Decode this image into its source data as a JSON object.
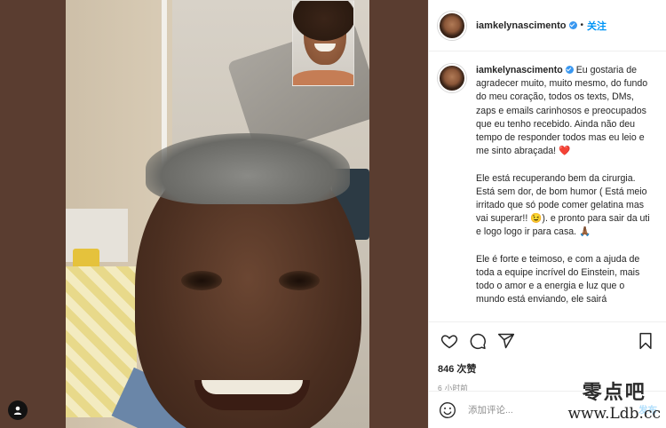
{
  "post": {
    "username": "iamkelynascimento",
    "follow_label": "关注",
    "dot": "•",
    "caption_username": "iamkelynascimento",
    "caption_p1": "Eu gostaria de agradecer muito, muito mesmo, do fundo do meu coração, todos os texts, DMs, zaps e emails carinhosos e preocupados que eu tenho recebido. Ainda não deu tempo de responder todos mas eu leio e me sinto abraçada!",
    "caption_p1_emoji": "❤️",
    "caption_p2": "Ele está recuperando bem da cirurgia. Está sem dor, de bom humor ( Está meio irritado que só pode comer gelatina mas vai superar!! 😉). e pronto para sair da uti e logo logo ir para casa. 🙏🏾",
    "caption_p3": "Ele é forte e teimoso, e com a ajuda de toda a equipe incrível do Einstein, mais todo o amor e a energia e luz que o mundo está enviando, ele sairá",
    "likes": "846 次赞",
    "time": "6 小时前",
    "comment_placeholder": "添加评论...",
    "post_label": "发布"
  },
  "icons": {
    "like": "heart-icon",
    "comment": "comment-bubble-icon",
    "share": "paper-plane-icon",
    "save": "bookmark-icon",
    "emoji": "smiley-icon",
    "tags": "person-tag-icon"
  },
  "watermark": {
    "chinese": "零点吧",
    "url": "www.Ldb.cc"
  },
  "colors": {
    "accent": "#0095f6",
    "verified": "#3897f0",
    "heart": "#ed1c3a"
  }
}
